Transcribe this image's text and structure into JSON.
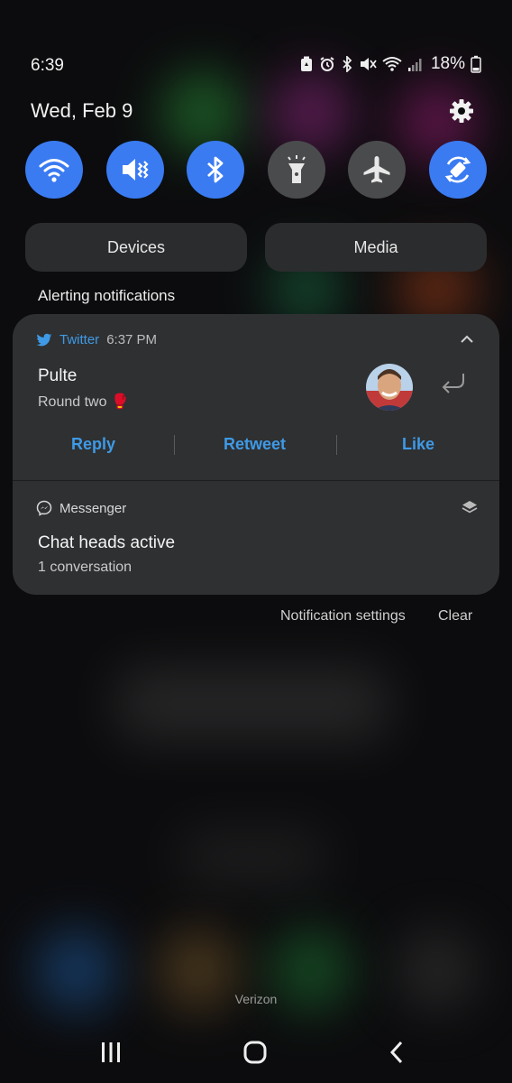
{
  "status": {
    "time": "6:39",
    "battery_pct": "18%"
  },
  "panel": {
    "date": "Wed, Feb 9"
  },
  "quick_settings": [
    {
      "icon": "wifi-icon",
      "state": "on"
    },
    {
      "icon": "mute-icon",
      "state": "on"
    },
    {
      "icon": "bluetooth-icon",
      "state": "on"
    },
    {
      "icon": "flashlight-icon",
      "state": "off"
    },
    {
      "icon": "airplane-icon",
      "state": "off"
    },
    {
      "icon": "auto-rotate-icon",
      "state": "on"
    }
  ],
  "pills": {
    "devices": "Devices",
    "media": "Media"
  },
  "section_title": "Alerting notifications",
  "twitter": {
    "app": "Twitter",
    "time": "6:37 PM",
    "title": "Pulte",
    "body": "Round two 🥊",
    "actions": {
      "reply": "Reply",
      "retweet": "Retweet",
      "like": "Like"
    }
  },
  "messenger": {
    "app": "Messenger",
    "title": "Chat heads active",
    "body": "1 conversation"
  },
  "footer": {
    "settings": "Notification settings",
    "clear": "Clear"
  },
  "carrier": "Verizon",
  "colors": {
    "accent": "#3a7bf2",
    "link": "#3e9ae6",
    "card": "#2f3032",
    "tile_off": "#4a4b4d"
  }
}
